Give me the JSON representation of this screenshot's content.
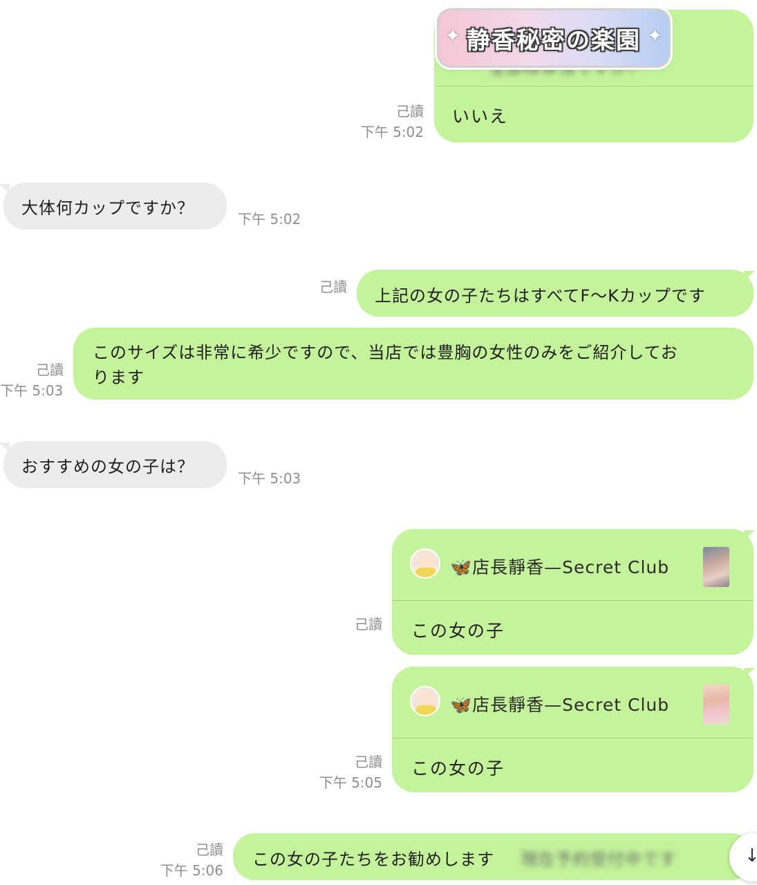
{
  "colors": {
    "outgoing_bubble": "#c5f39b",
    "incoming_bubble": "#ececec",
    "meta_text": "#8e8e8e"
  },
  "logo": {
    "text": "静香秘密の楽園",
    "sparkle": "✦"
  },
  "messages": [
    {
      "id": "m1",
      "direction": "outgoing",
      "blurred_question": "全部は本当ですか？",
      "text": "いいえ",
      "read_label": "己讀",
      "time": "下午 5:02"
    },
    {
      "id": "m2",
      "direction": "incoming",
      "text": "大体何カップですか？",
      "time": "下午 5:02"
    },
    {
      "id": "m3",
      "direction": "outgoing",
      "text": "上記の女の子たちはすべてF～Kカップです",
      "read_label": "己讀"
    },
    {
      "id": "m4",
      "direction": "outgoing",
      "line1": "このサイズは非常に希少ですので、当店では豊胸の女性のみをご紹介してお",
      "line2": "ります",
      "read_label": "己讀",
      "time": "下午 5:03"
    },
    {
      "id": "m5",
      "direction": "incoming",
      "text": "おすすめの女の子は？",
      "time": "下午 5:03"
    },
    {
      "id": "m6",
      "direction": "outgoing",
      "type": "shared-card",
      "card_title": "🦋店長靜香—Secret Club",
      "text": "この女の子",
      "read_label": "己讀"
    },
    {
      "id": "m7",
      "direction": "outgoing",
      "type": "shared-card",
      "card_title": "🦋店長靜香—Secret Club",
      "text": "この女の子",
      "read_label": "己讀",
      "time": "下午 5:05"
    },
    {
      "id": "m8",
      "direction": "outgoing",
      "text": "この女の子たちをお勧めします",
      "blurred_tail": "現在予約受付中です",
      "read_label": "己讀",
      "time": "下午 5:06"
    }
  ],
  "scroll_button": {
    "icon": "arrow-down-icon",
    "glyph": "↓"
  }
}
